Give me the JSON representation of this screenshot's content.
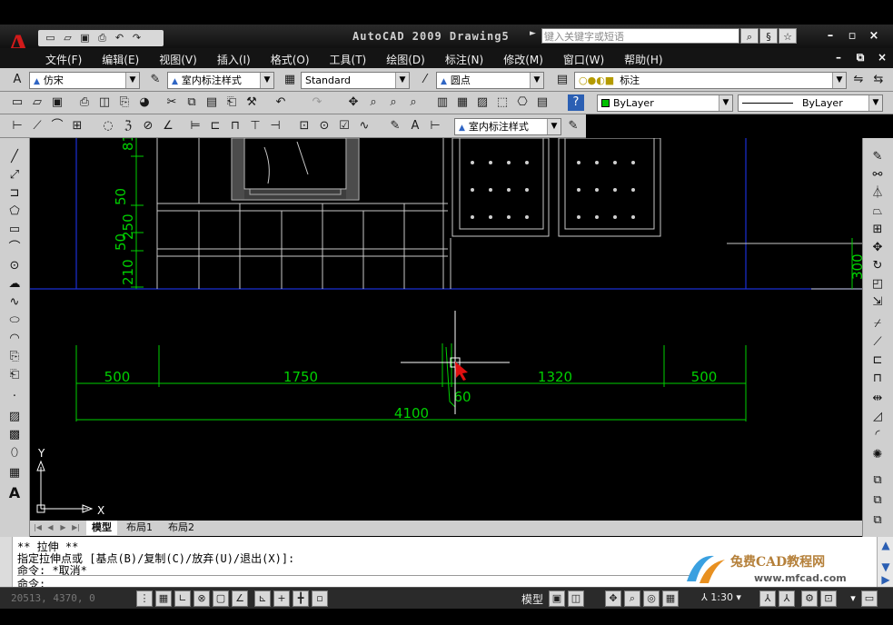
{
  "app": {
    "title": "AutoCAD 2009  Drawing5",
    "logo_letter": "A",
    "search_placeholder": "键入关键字或短语"
  },
  "menu": [
    "文件(F)",
    "编辑(E)",
    "视图(V)",
    "插入(I)",
    "格式(O)",
    "工具(T)",
    "绘图(D)",
    "标注(N)",
    "修改(M)",
    "窗口(W)",
    "帮助(H)"
  ],
  "toolbar1": {
    "font_combo": "仿宋",
    "dimstyle_combo": "室内标注样式",
    "table_style_combo": "Standard",
    "multileader_combo": "圆点",
    "layer_combo": "标注"
  },
  "toolbar2": {
    "color_combo": "ByLayer",
    "linetype_combo": "ByLayer"
  },
  "toolbar3": {
    "dimstyle_combo": "室内标注样式"
  },
  "drawing": {
    "dims_horizontal": [
      "500",
      "1750",
      "1320",
      "500"
    ],
    "dim_total": "4100",
    "dim_small": "60",
    "dims_vertical": [
      "81",
      "50",
      "250",
      "50",
      "210"
    ],
    "dim_right": "300",
    "ucs_x": "X",
    "ucs_y": "Y",
    "colors": {
      "background": "#000000",
      "dimension": "#00d000",
      "geometry": "#c8c8c8",
      "boundary": "#1a2fd4",
      "cursor": "#ffffff",
      "pick_marker": "#e01010"
    }
  },
  "layout_tabs": [
    "模型",
    "布局1",
    "布局2"
  ],
  "command": {
    "lines": [
      "** 拉伸 **",
      "指定拉伸点或 [基点(B)/复制(C)/放弃(U)/退出(X)]:",
      "命令: *取消*",
      "命令:"
    ]
  },
  "status": {
    "coordinates": "20513, 4370, 0",
    "model_label": "模型",
    "annotation_scale": "1:30"
  },
  "watermark": {
    "title": "兔费CAD教程网",
    "url": "www.mfcad.com"
  }
}
